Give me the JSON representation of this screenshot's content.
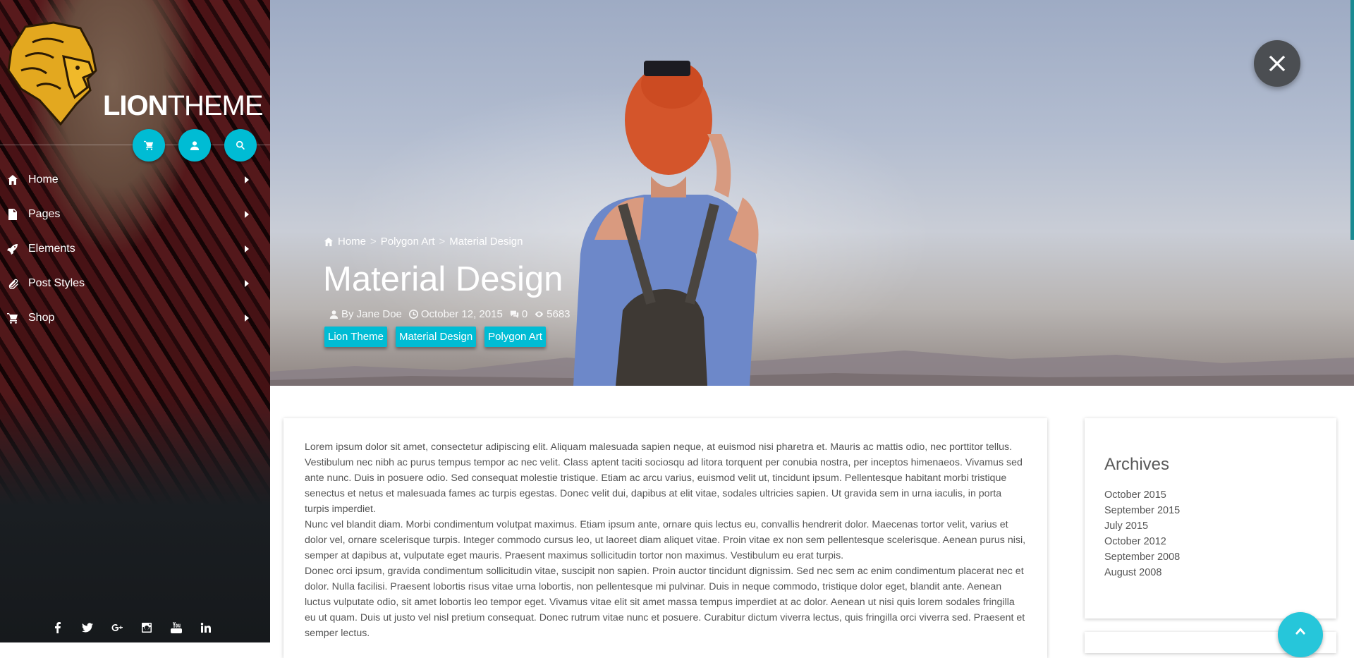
{
  "brand": {
    "bold": "LION",
    "light": "THEME"
  },
  "header_icons": [
    {
      "name": "cart-icon"
    },
    {
      "name": "user-icon"
    },
    {
      "name": "search-icon"
    }
  ],
  "nav": {
    "items": [
      {
        "label": "Home",
        "icon": "home-icon"
      },
      {
        "label": "Pages",
        "icon": "file-icon"
      },
      {
        "label": "Elements",
        "icon": "rocket-icon"
      },
      {
        "label": "Post Styles",
        "icon": "paperclip-icon"
      },
      {
        "label": "Shop",
        "icon": "cart-icon"
      }
    ]
  },
  "social": [
    "facebook-icon",
    "twitter-icon",
    "google-plus-icon",
    "instagram-icon",
    "youtube-icon",
    "linkedin-icon"
  ],
  "breadcrumb": {
    "home": "Home",
    "sep": ">",
    "category": "Polygon Art",
    "current": "Material Design"
  },
  "post": {
    "title": "Material Design",
    "author": "By Jane Doe",
    "date": "October 12, 2015",
    "comments": "0",
    "views": "5683",
    "tags": [
      "Lion Theme",
      "Material Design",
      "Polygon Art"
    ],
    "paragraphs": [
      "Lorem ipsum dolor sit amet, consectetur adipiscing elit. Aliquam malesuada sapien neque, at euismod nisi pharetra et. Mauris ac mattis odio, nec porttitor tellus. Vestibulum nec nibh ac purus tempus tempor ac nec velit. Class aptent taciti sociosqu ad litora torquent per conubia nostra, per inceptos himenaeos. Vivamus sed ante nunc. Duis in posuere odio. Sed consequat molestie tristique. Etiam ac arcu varius, euismod velit ut, tincidunt ipsum. Pellentesque habitant morbi tristique senectus et netus et malesuada fames ac turpis egestas. Donec velit dui, dapibus at elit vitae, sodales ultricies sapien. Ut gravida sem in urna iaculis, in porta turpis imperdiet.",
      "Nunc vel blandit diam. Morbi condimentum volutpat maximus. Etiam ipsum ante, ornare quis lectus eu, convallis hendrerit dolor. Maecenas tortor velit, varius et dolor vel, ornare scelerisque turpis. Integer commodo cursus leo, ut laoreet diam aliquet vitae. Proin vitae ex non sem pellentesque scelerisque. Aenean purus nisi, semper at dapibus at, vulputate eget mauris. Praesent maximus sollicitudin tortor non maximus. Vestibulum eu erat turpis.",
      "Donec orci ipsum, gravida condimentum sollicitudin vitae, suscipit non sapien. Proin auctor tincidunt dignissim. Sed nec sem ac enim condimentum placerat nec et dolor. Nulla facilisi. Praesent lobortis risus vitae urna lobortis, non pellentesque mi pulvinar. Duis in neque commodo, tristique dolor eget, blandit ante. Aenean luctus vulputate odio, sit amet lobortis leo tempor eget. Vivamus vitae elit sit amet massa tempus imperdiet at ac dolor. Aenean ut nisi quis lorem sodales fringilla eu ut quam. Duis ut justo vel nisl pretium consequat. Donec rutrum vitae nunc et posuere. Curabitur dictum viverra lectus, quis fringilla orci viverra sed. Praesent et semper lectus."
    ]
  },
  "archives": {
    "title": "Archives",
    "items": [
      "October 2015",
      "September 2015",
      "July 2015",
      "October 2012",
      "September 2008",
      "August 2008"
    ]
  },
  "colors": {
    "accent": "#00bcd4",
    "close_button": "#4b4e52"
  }
}
